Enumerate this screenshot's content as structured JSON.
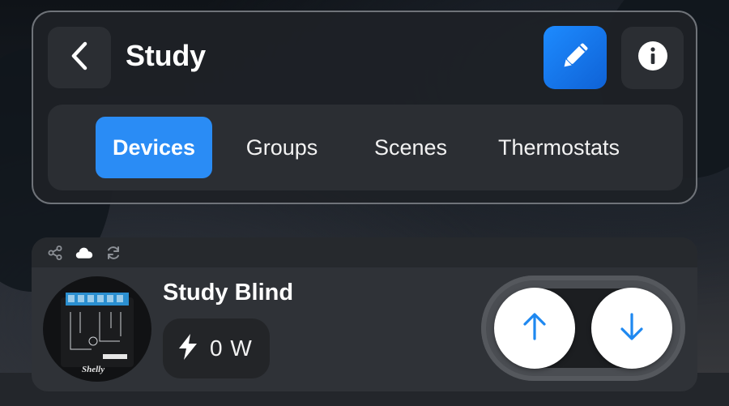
{
  "header": {
    "title": "Study",
    "back_icon": "chevron-left-icon",
    "edit_icon": "pencil-icon",
    "info_icon": "info-icon",
    "accent_color": "#2a8cf5"
  },
  "tabs": [
    {
      "label": "Devices",
      "active": true
    },
    {
      "label": "Groups",
      "active": false
    },
    {
      "label": "Scenes",
      "active": false
    },
    {
      "label": "Thermostats",
      "active": false
    }
  ],
  "device": {
    "status_icons": [
      "share-icon",
      "cloud-icon",
      "sync-icon"
    ],
    "image_icon": "shelly-relay-module",
    "name": "Study Blind",
    "power_icon": "lightning-bolt-icon",
    "power": "0 W",
    "controls": {
      "up_icon": "arrow-up-icon",
      "down_icon": "arrow-down-icon"
    }
  }
}
